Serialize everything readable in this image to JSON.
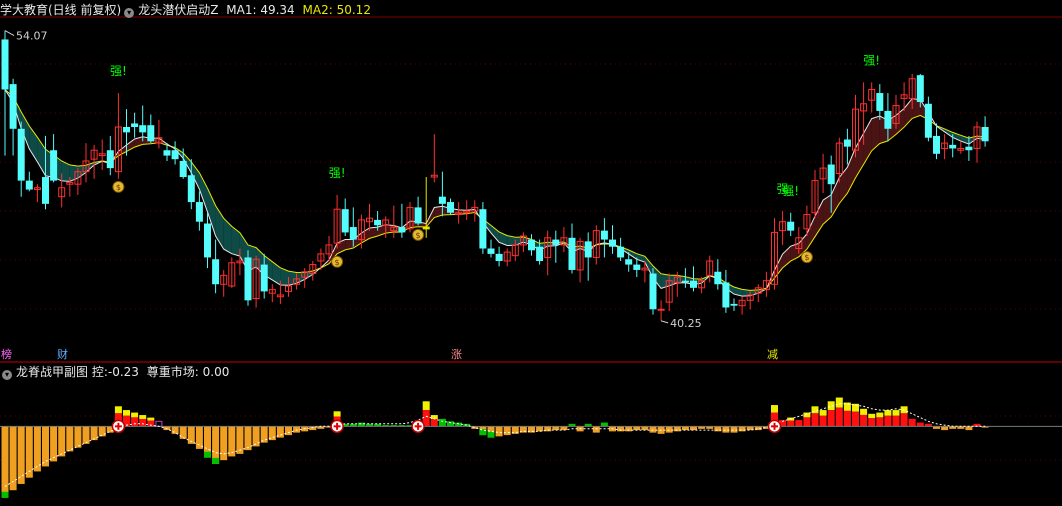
{
  "header": {
    "title": "学大教育(日线 前复权)",
    "indicator": "龙头潜伏启动Z",
    "ma1_label": "MA1:",
    "ma1_value": "49.34",
    "ma2_label": "MA2:",
    "ma2_value": "50.12"
  },
  "sub_header": {
    "title": "龙脊战甲副图",
    "ctrl_label": "控:",
    "ctrl_value": "-0.23",
    "respect_label": "尊重市场:",
    "respect_value": "0.00"
  },
  "badges": [
    {
      "text": "榜",
      "color": "#ff66ff"
    },
    {
      "text": "财",
      "color": "#5fb0ff"
    },
    {
      "text": "涨",
      "color": "#ff8a8a"
    },
    {
      "text": "减",
      "color": "#e8e800"
    }
  ],
  "colors": {
    "up": "#ff3030",
    "down": "#54fcfc",
    "ma1": "#e8e8e8",
    "ma2": "#e8e800",
    "ribbon_bear": "#0e4a46",
    "ribbon_bull": "#4a1414",
    "signal": "#e8e800",
    "strong": "#00ff00",
    "bar_orange": "#f0a020",
    "bar_red": "#ff1010",
    "bar_yellow": "#f0f000",
    "bar_green": "#00c000",
    "bar_magenta": "#c040c0"
  },
  "chart_data": {
    "type": "candlestick",
    "price_range": [
      38.9,
      57.2
    ],
    "annotations": {
      "high_label": "54.07",
      "low_label": "40.25",
      "strong_label": "强!",
      "strong_label_short": "强"
    },
    "ohlc": [
      [
        56.0,
        56.5,
        49.5,
        53.2
      ],
      [
        53.5,
        53.8,
        49.5,
        51.0
      ],
      [
        51.0,
        51.4,
        47.2,
        48.1
      ],
      [
        48.1,
        48.6,
        47.5,
        47.6
      ],
      [
        47.6,
        47.9,
        46.9,
        47.7
      ],
      [
        48.3,
        50.6,
        46.5,
        46.8
      ],
      [
        49.8,
        50.7,
        48.0,
        48.1
      ],
      [
        47.2,
        48.5,
        46.6,
        47.7
      ],
      [
        47.9,
        48.3,
        47.2,
        48.0
      ],
      [
        47.9,
        48.8,
        47.3,
        48.6
      ],
      [
        48.6,
        50.2,
        48.0,
        49.2
      ],
      [
        49.3,
        50.1,
        48.2,
        49.8
      ],
      [
        49.5,
        50.4,
        48.7,
        49.6
      ],
      [
        49.8,
        50.6,
        48.4,
        48.8
      ],
      [
        48.6,
        53.0,
        48.2,
        51.1
      ],
      [
        51.1,
        52.1,
        49.5,
        50.8
      ],
      [
        51.3,
        51.9,
        50.5,
        51.1
      ],
      [
        51.2,
        52.3,
        50.3,
        50.8
      ],
      [
        51.2,
        51.8,
        50.2,
        50.3
      ],
      [
        50.2,
        51.5,
        49.9,
        50.5
      ],
      [
        49.8,
        50.2,
        49.2,
        49.5
      ],
      [
        49.8,
        50.3,
        49.0,
        49.3
      ],
      [
        49.2,
        49.9,
        48.2,
        48.3
      ],
      [
        48.4,
        49.3,
        46.5,
        46.9
      ],
      [
        46.9,
        47.5,
        45.3,
        45.8
      ],
      [
        45.7,
        46.3,
        43.2,
        43.8
      ],
      [
        43.7,
        44.8,
        41.8,
        42.3
      ],
      [
        42.3,
        43.1,
        41.6,
        42.8
      ],
      [
        42.2,
        43.8,
        42.1,
        43.5
      ],
      [
        43.5,
        44.3,
        42.8,
        43.6
      ],
      [
        43.8,
        44.2,
        41.1,
        41.4
      ],
      [
        41.5,
        43.9,
        41.0,
        43.7
      ],
      [
        43.4,
        44.0,
        41.5,
        41.9
      ],
      [
        41.8,
        42.3,
        41.3,
        42.0
      ],
      [
        41.6,
        42.5,
        41.2,
        41.7
      ],
      [
        41.9,
        42.7,
        41.6,
        42.2
      ],
      [
        42.3,
        42.9,
        42.0,
        42.6
      ],
      [
        42.7,
        43.2,
        42.1,
        43.0
      ],
      [
        42.9,
        43.6,
        42.5,
        43.4
      ],
      [
        43.6,
        44.3,
        43.1,
        44.0
      ],
      [
        44.0,
        45.0,
        43.6,
        44.5
      ],
      [
        44.6,
        47.3,
        44.3,
        46.5
      ],
      [
        46.5,
        47.1,
        45.0,
        45.2
      ],
      [
        45.5,
        46.6,
        44.4,
        44.8
      ],
      [
        44.8,
        46.2,
        44.3,
        45.9
      ],
      [
        45.8,
        46.8,
        45.3,
        46.0
      ],
      [
        45.9,
        46.4,
        45.3,
        45.6
      ],
      [
        45.6,
        46.1,
        44.9,
        45.9
      ],
      [
        45.3,
        46.7,
        44.9,
        45.5
      ],
      [
        45.5,
        46.8,
        44.9,
        45.2
      ],
      [
        45.4,
        46.9,
        45.2,
        46.6
      ],
      [
        46.6,
        47.2,
        45.6,
        45.7
      ],
      [
        45.4,
        48.3,
        44.9,
        45.5
      ],
      [
        48.3,
        50.7,
        48.0,
        48.4
      ],
      [
        47.2,
        48.6,
        46.1,
        46.8
      ],
      [
        46.9,
        47.1,
        46.2,
        46.3
      ],
      [
        46.2,
        46.9,
        45.7,
        46.3
      ],
      [
        46.3,
        47.0,
        45.9,
        46.4
      ],
      [
        46.4,
        47.0,
        45.8,
        46.6
      ],
      [
        46.5,
        46.9,
        44.0,
        44.3
      ],
      [
        44.3,
        44.8,
        43.8,
        44.0
      ],
      [
        44.0,
        44.4,
        43.3,
        43.6
      ],
      [
        43.6,
        44.3,
        43.3,
        44.1
      ],
      [
        43.9,
        44.8,
        43.6,
        44.5
      ],
      [
        44.5,
        45.2,
        44.1,
        45.0
      ],
      [
        44.8,
        45.1,
        43.9,
        44.2
      ],
      [
        44.4,
        44.8,
        43.4,
        43.6
      ],
      [
        43.8,
        45.3,
        42.8,
        44.9
      ],
      [
        44.8,
        45.3,
        43.5,
        44.5
      ],
      [
        44.5,
        45.5,
        44.1,
        44.9
      ],
      [
        44.9,
        45.7,
        42.9,
        43.1
      ],
      [
        43.1,
        44.9,
        42.4,
        44.7
      ],
      [
        44.7,
        45.2,
        42.5,
        43.8
      ],
      [
        43.8,
        45.6,
        43.4,
        45.3
      ],
      [
        45.3,
        46.0,
        43.8,
        44.8
      ],
      [
        44.8,
        45.6,
        44.0,
        44.4
      ],
      [
        44.4,
        44.9,
        43.6,
        43.8
      ],
      [
        43.7,
        44.1,
        43.0,
        43.4
      ],
      [
        43.4,
        43.8,
        42.7,
        43.1
      ],
      [
        43.1,
        43.6,
        42.4,
        43.2
      ],
      [
        42.9,
        43.2,
        40.6,
        40.9
      ],
      [
        40.9,
        41.4,
        40.25,
        40.9
      ],
      [
        41.3,
        42.9,
        40.8,
        42.5
      ],
      [
        42.4,
        43.0,
        41.6,
        42.7
      ],
      [
        42.5,
        43.2,
        42.1,
        42.4
      ],
      [
        42.5,
        43.3,
        41.9,
        42.1
      ],
      [
        42.1,
        42.7,
        41.8,
        42.5
      ],
      [
        42.8,
        43.9,
        42.4,
        43.6
      ],
      [
        43.0,
        43.7,
        42.0,
        42.3
      ],
      [
        42.4,
        43.1,
        40.7,
        41.0
      ],
      [
        41.2,
        41.5,
        40.8,
        41.1
      ],
      [
        41.1,
        41.6,
        40.6,
        41.4
      ],
      [
        41.4,
        41.9,
        40.9,
        41.7
      ],
      [
        41.8,
        42.3,
        41.3,
        42.1
      ],
      [
        42.0,
        43.0,
        41.6,
        42.5
      ],
      [
        42.3,
        46.0,
        42.0,
        45.2
      ],
      [
        45.3,
        46.4,
        44.5,
        45.8
      ],
      [
        45.8,
        46.3,
        45.0,
        45.3
      ],
      [
        44.3,
        45.5,
        44.0,
        44.9
      ],
      [
        45.4,
        46.7,
        45.0,
        46.2
      ],
      [
        46.3,
        48.7,
        46.0,
        48.1
      ],
      [
        48.2,
        49.6,
        47.4,
        48.8
      ],
      [
        49.0,
        49.5,
        46.3,
        47.9
      ],
      [
        48.5,
        50.5,
        48.0,
        50.2
      ],
      [
        50.4,
        51.0,
        49.0,
        50.0
      ],
      [
        49.8,
        52.9,
        49.4,
        52.1
      ],
      [
        52.0,
        53.6,
        50.1,
        52.4
      ],
      [
        52.6,
        53.6,
        51.9,
        53.2
      ],
      [
        53.0,
        53.5,
        51.5,
        52.0
      ],
      [
        52.0,
        53.0,
        50.3,
        51.0
      ],
      [
        51.3,
        52.9,
        51.0,
        52.3
      ],
      [
        52.7,
        53.6,
        52.0,
        52.9
      ],
      [
        52.7,
        54.07,
        52.1,
        53.8
      ],
      [
        54.0,
        54.07,
        52.2,
        52.5
      ],
      [
        52.4,
        52.8,
        50.3,
        50.5
      ],
      [
        50.6,
        51.3,
        49.3,
        49.6
      ],
      [
        49.9,
        50.7,
        49.3,
        50.2
      ],
      [
        50.1,
        50.7,
        49.4,
        49.9
      ],
      [
        49.8,
        50.3,
        49.6,
        49.9
      ],
      [
        50.0,
        50.6,
        49.2,
        49.8
      ],
      [
        49.9,
        51.4,
        49.1,
        51.1
      ],
      [
        51.1,
        51.7,
        50.0,
        50.3
      ]
    ],
    "signals": [
      {
        "index": 14,
        "type": "money"
      },
      {
        "index": 41,
        "type": "money"
      },
      {
        "index": 51,
        "type": "money"
      },
      {
        "index": 99,
        "type": "money"
      },
      {
        "index": 14,
        "type": "strong"
      },
      {
        "index": 41,
        "type": "strong"
      },
      {
        "index": 97,
        "type": "strong"
      },
      {
        "index": 107,
        "type": "strong"
      },
      {
        "index": 96,
        "type": "strong_short"
      }
    ],
    "special_yellow_bar_index": 52,
    "sub_range": [
      -6.2,
      3.7
    ],
    "sub_values": [
      -5.7,
      -5.1,
      -4.6,
      -4.1,
      -3.6,
      -3.2,
      -2.8,
      -2.4,
      -2.0,
      -1.7,
      -1.4,
      -1.1,
      -0.8,
      -0.5,
      1.6,
      1.3,
      1.1,
      0.9,
      0.7,
      0.4,
      -0.3,
      -0.6,
      -1.0,
      -1.4,
      -1.8,
      -2.5,
      -3.0,
      -2.7,
      -2.4,
      -2.2,
      -1.9,
      -1.6,
      -1.3,
      -1.1,
      -0.9,
      -0.7,
      -0.5,
      -0.4,
      -0.3,
      -0.2,
      -0.1,
      1.2,
      0.2,
      0.2,
      0.3,
      0.2,
      0.2,
      0.1,
      0.1,
      0.1,
      0.1,
      0.3,
      2.0,
      0.9,
      0.6,
      0.4,
      0.3,
      0.2,
      -0.2,
      -0.7,
      -0.9,
      -0.8,
      -0.7,
      -0.6,
      -0.5,
      -0.5,
      -0.4,
      -0.4,
      -0.3,
      -0.3,
      0.2,
      -0.4,
      0.2,
      -0.5,
      0.3,
      -0.4,
      -0.4,
      -0.4,
      -0.3,
      -0.3,
      -0.5,
      -0.6,
      -0.5,
      -0.4,
      -0.3,
      -0.3,
      -0.2,
      -0.2,
      -0.4,
      -0.5,
      -0.5,
      -0.4,
      -0.3,
      -0.3,
      -0.2,
      1.7,
      0.5,
      0.7,
      0.5,
      1.1,
      1.6,
      1.3,
      2.0,
      2.3,
      1.9,
      1.8,
      1.4,
      1.0,
      1.1,
      1.3,
      1.3,
      1.6,
      0.6,
      0.3,
      0.2,
      -0.2,
      -0.3,
      -0.2,
      -0.2,
      -0.3,
      0.2,
      -0.1
    ],
    "sub_trend": [
      -4.8,
      -4.4,
      -4.0,
      -3.6,
      -3.2,
      -2.8,
      -2.5,
      -2.2,
      -1.9,
      -1.6,
      -1.3,
      -1.0,
      -0.7,
      -0.4,
      -0.1,
      0.1,
      0.2,
      0.2,
      0.1,
      0.0,
      -0.2,
      -0.5,
      -0.9,
      -1.2,
      -1.5,
      -1.8,
      -2.1,
      -2.2,
      -2.1,
      -1.9,
      -1.7,
      -1.4,
      -1.1,
      -0.9,
      -0.7,
      -0.5,
      -0.3,
      -0.2,
      -0.1,
      0.0,
      0.0,
      0.1,
      0.2,
      0.2,
      0.2,
      0.2,
      0.2,
      0.2,
      0.2,
      0.2,
      0.3,
      0.5,
      0.8,
      0.6,
      0.4,
      0.3,
      0.2,
      0.1,
      -0.1,
      -0.3,
      -0.4,
      -0.5,
      -0.5,
      -0.5,
      -0.4,
      -0.4,
      -0.4,
      -0.3,
      -0.3,
      -0.3,
      -0.2,
      -0.2,
      -0.2,
      -0.2,
      -0.2,
      -0.2,
      -0.3,
      -0.3,
      -0.3,
      -0.3,
      -0.3,
      -0.3,
      -0.3,
      -0.3,
      -0.3,
      -0.3,
      -0.3,
      -0.3,
      -0.3,
      -0.3,
      -0.3,
      -0.3,
      -0.3,
      -0.2,
      -0.1,
      0.2,
      0.4,
      0.6,
      0.8,
      1.0,
      1.2,
      1.4,
      1.6,
      1.8,
      1.8,
      1.7,
      1.6,
      1.4,
      1.3,
      1.3,
      1.4,
      1.3,
      1.0,
      0.7,
      0.4,
      0.2,
      0.1,
      0.0,
      0.0,
      0.0,
      0.0,
      0.0
    ],
    "sub_markers": [
      14,
      41,
      51,
      95
    ]
  }
}
